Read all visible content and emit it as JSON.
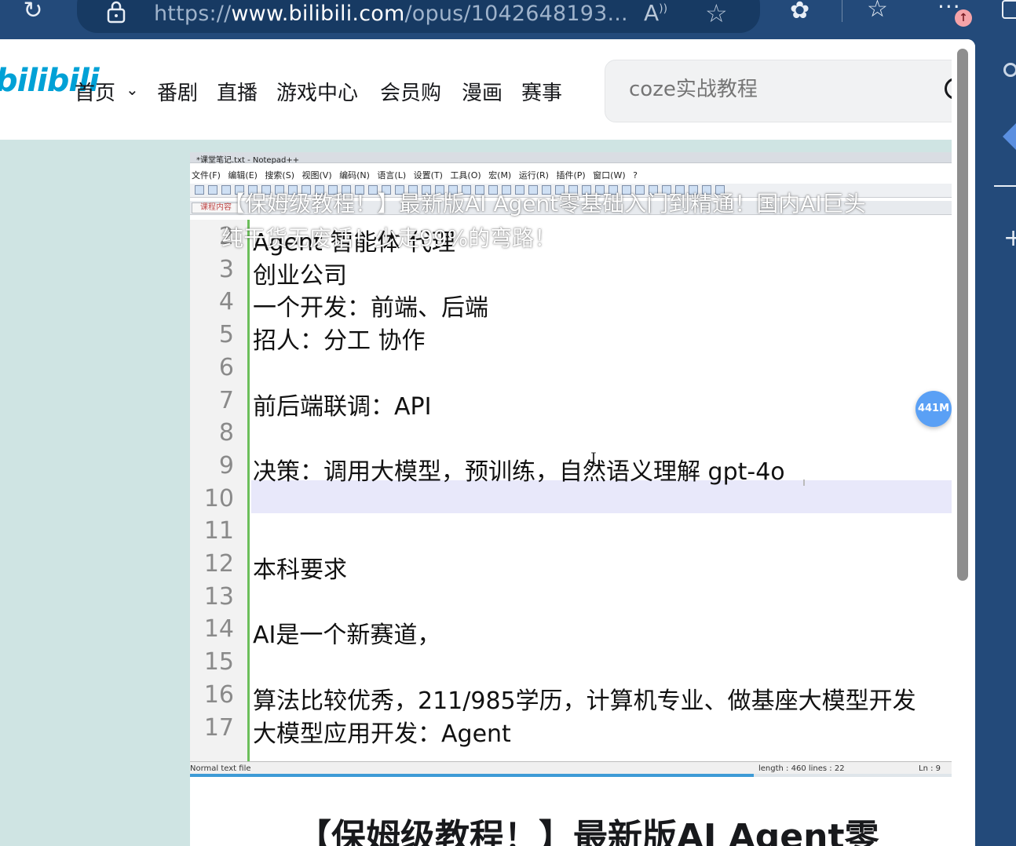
{
  "browser": {
    "url_prefix": "https://",
    "url_host": "www.bilibili.com",
    "url_path": "/opus/1042648193...",
    "update_badge": "↑"
  },
  "site": {
    "logo": "bilibili",
    "nav": [
      "首页",
      "番剧",
      "直播",
      "游戏中心",
      "会员购",
      "漫画",
      "赛事"
    ],
    "search_placeholder": "coze实战教程"
  },
  "video": {
    "window_title": "*课堂笔记.txt - Notepad++",
    "menu": "文件(F) 编辑(E) 搜索(S) 视图(V) 编码(N) 语言(L) 设置(T) 工具(O) 宏(M) 运行(R) 插件(P) 窗口(W) ?",
    "tab": "课程内容",
    "overlay_title_line1": "【保姆级教程！】最新版AI Agent零基础入门到精通！国内AI巨头",
    "overlay_title_line2": "纯干货无废话！少走99%的弯路！",
    "lines": [
      {
        "n": "2",
        "text": "Agent 智能体 代理"
      },
      {
        "n": "3",
        "text": "创业公司"
      },
      {
        "n": "4",
        "text": "一个开发：前端、后端"
      },
      {
        "n": "5",
        "text": "招人：分工 协作"
      },
      {
        "n": "6",
        "text": ""
      },
      {
        "n": "7",
        "text": "前后端联调：API"
      },
      {
        "n": "8",
        "text": ""
      },
      {
        "n": "9",
        "text": "决策：调用大模型，预训练，自然语义理解 gpt-4o"
      },
      {
        "n": "10",
        "text": ""
      },
      {
        "n": "11",
        "text": ""
      },
      {
        "n": "12",
        "text": "本科要求"
      },
      {
        "n": "13",
        "text": ""
      },
      {
        "n": "14",
        "text": "AI是一个新赛道，"
      },
      {
        "n": "15",
        "text": ""
      },
      {
        "n": "16",
        "text": "算法比较优秀，211/985学历，计算机专业、做基座大模型开发"
      },
      {
        "n": "17",
        "text": "大模型应用开发：Agent"
      }
    ],
    "status_type": "Normal text file",
    "status_length": "length : 460    lines : 22",
    "status_ln": "Ln : 9",
    "progress_fraction": 0.74,
    "memory_badge": "441M"
  },
  "article": {
    "title": "【保姆级教程！】最新版AI Agent零"
  },
  "colors": {
    "browser_chrome": "#234a7a",
    "page_bg": "#cfe4e3",
    "bili_blue": "#00a1d6",
    "gutter_green": "#6cbf5b"
  }
}
